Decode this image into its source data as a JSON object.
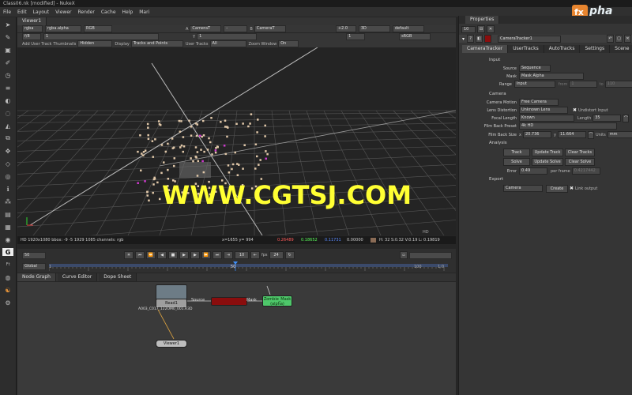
{
  "window": {
    "title": "Class06.nk [modified] - NukeX"
  },
  "menu": [
    "File",
    "Edit",
    "Layout",
    "Viewer",
    "Render",
    "Cache",
    "Help",
    "Mari"
  ],
  "viewer": {
    "tab": "Viewer1",
    "row1": {
      "channels": "rgba",
      "alpha": "rgba.alpha",
      "colorspace": "RGB",
      "a_label": "A",
      "a_input": "CameraT",
      "dash": "-",
      "b_label": "B",
      "b_input": "CameraT",
      "gain": "+2.0",
      "mode": "3D",
      "lut": "default"
    },
    "row2": {
      "fstop": "f/8",
      "gain_val": "1",
      "y_label": "Y",
      "y_val": "1",
      "zoom": "1",
      "srgb": "sRGB"
    },
    "row3": {
      "add_user_track": "Add User Track",
      "thumbnails_label": "Thumbnails",
      "thumbnails": "Hidden",
      "display_label": "Display",
      "display": "Tracks and Points",
      "user_tracks_label": "User Tracks",
      "user_tracks": "All",
      "zoom_window_label": "Zoom Window",
      "zoom_window": "On"
    },
    "hd_label": "HD",
    "info": {
      "format": "HD 1920x1080 bbox: -9 -5 1929 1085 channels: rgb",
      "coords": "x=1655 y= 994",
      "r": "0.26489",
      "g": "0.18652",
      "b": "0.11731",
      "a": "0.00000",
      "hsvl": "H: 32 S:0.32 V:0.19  L: 0.19819"
    },
    "watermark": "WWW.CGTSJ.COM"
  },
  "timeline": {
    "frame": "50",
    "range_mode": "Global",
    "ticks": [
      "1",
      "50",
      "100",
      "1:0"
    ],
    "step": "10",
    "fps_label": "fps",
    "fps": "24",
    "colors": {
      "playhead": "#3e8ef7",
      "range": "#4a6fd0"
    }
  },
  "nodegraph": {
    "tabs": [
      "Node Graph",
      "Curve Editor",
      "Dope Sheet"
    ],
    "nodes": {
      "read": {
        "name": "Read1",
        "file": "A003_C017_122OM0_001.R3D"
      },
      "source_label": "Source",
      "mask_label": "Mask",
      "zombie": {
        "name": "Zombie_Mask",
        "sub": "(alpha)"
      },
      "viewer": {
        "name": "Viewer1"
      }
    }
  },
  "properties": {
    "title": "Properties",
    "max_panels": "10",
    "node_name": "CameraTracker1",
    "tabs": [
      "CameraTracker",
      "UserTracks",
      "AutoTracks",
      "Settings",
      "Scene"
    ],
    "input_section": "Input",
    "source": {
      "label": "Source",
      "value": "Sequence"
    },
    "mask": {
      "label": "Mask",
      "value": "Mask Alpha"
    },
    "range": {
      "label": "Range",
      "value": "Input",
      "from_label": "from",
      "from": "1",
      "to_label": "to",
      "to": "110"
    },
    "camera_section": "Camera",
    "camera_motion": {
      "label": "Camera Motion",
      "value": "Free Camera"
    },
    "lens_distortion": {
      "label": "Lens Distortion",
      "value": "Unknown Lens",
      "undistort": "Undistort Input"
    },
    "focal_length": {
      "label": "Focal Length",
      "value": "Known",
      "length_label": "Length",
      "length": "35"
    },
    "film_back_preset": {
      "label": "Film Back Preset",
      "value": "4k HD"
    },
    "film_back_size": {
      "label": "Film Back Size",
      "x_label": "x",
      "x": "20.736",
      "y_label": "y",
      "y": "11.664",
      "units_label": "Units",
      "units": "mm"
    },
    "analysis_section": "Analysis",
    "buttons": {
      "track": "Track",
      "update_track": "Update Track",
      "clear_tracks": "Clear Tracks",
      "solve": "Solve",
      "update_solve": "Update Solve",
      "clear_solve": "Clear Solve"
    },
    "error": {
      "label": "Error",
      "value": "0.49",
      "per_frame": "per frame",
      "per_frame_val": "0.4217442"
    },
    "export_section": "Export",
    "export": {
      "value": "Camera",
      "create": "Create",
      "link": "Link output"
    }
  },
  "logo": {
    "text": "pha"
  }
}
